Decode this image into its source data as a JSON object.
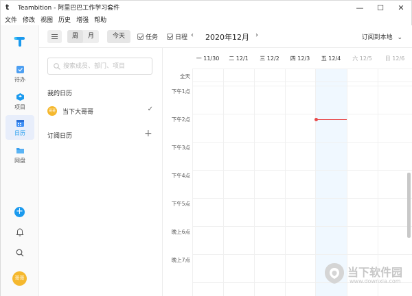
{
  "window": {
    "title": "Teambition - 阿里巴巴工作学习套件",
    "controls": [
      "minimize",
      "maximize",
      "close"
    ]
  },
  "menubar": [
    "文件",
    "修改",
    "视图",
    "历史",
    "增强",
    "帮助"
  ],
  "rail": {
    "items": [
      {
        "label": "待办",
        "icon": "todo-icon",
        "color": "#4d9ff2"
      },
      {
        "label": "项目",
        "icon": "project-icon",
        "color": "#1b9aee"
      },
      {
        "label": "日历",
        "icon": "calendar-icon",
        "color": "#3d8ef5",
        "active": true
      },
      {
        "label": "网盘",
        "icon": "folder-icon",
        "color": "#3aa0f0"
      }
    ],
    "avatar_text": "哥哥"
  },
  "toolbar": {
    "view_week": "周",
    "view_month": "月",
    "today": "今天",
    "task_filter": "任务",
    "event_filter": "日程",
    "prev": "‹",
    "month": "2020年12月",
    "next": "›",
    "subscribe": "订阅到本地"
  },
  "panel": {
    "search_placeholder": "搜索成员、部门、项目",
    "my_calendar_title": "我的日历",
    "my_calendar_item": "当下大哥哥",
    "avatar_text": "哥哥",
    "subscribed_title": "订阅日历"
  },
  "calendar": {
    "days": [
      {
        "label": "一 11/30",
        "weekend": false
      },
      {
        "label": "二 12/1",
        "weekend": false
      },
      {
        "label": "三 12/2",
        "weekend": false
      },
      {
        "label": "四 12/3",
        "weekend": false
      },
      {
        "label": "五 12/4",
        "weekend": false,
        "today": true
      },
      {
        "label": "六 12/5",
        "weekend": true
      },
      {
        "label": "日 12/6",
        "weekend": true
      }
    ],
    "all_day_label": "全天",
    "time_labels": [
      "下午1点",
      "下午2点",
      "下午3点",
      "下午4点",
      "下午5点",
      "晚上6点",
      "晚上7点"
    ],
    "now_color": "#e84a4a"
  },
  "watermark": {
    "text": "当下软件园",
    "url": "www.downxia.com"
  }
}
